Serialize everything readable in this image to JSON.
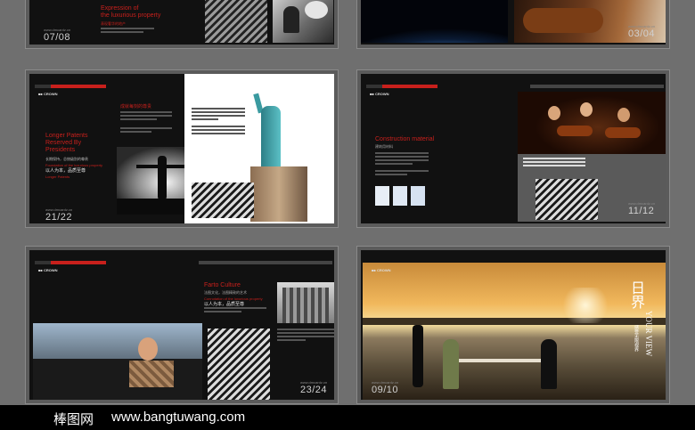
{
  "spreads": {
    "s1": {
      "title_line1": "Expression of",
      "title_line2": "the luxurious property",
      "title_cn": "表现奢华的地产",
      "url": "www.dmcardz.cn",
      "page": "07/08"
    },
    "s2": {
      "url": "www.dmcardz.cn",
      "page": "03/04"
    },
    "s3": {
      "heading_cn_small": "成就每刻的尊贵",
      "heading_line1": "Longer Patents",
      "heading_line2": "Reserved By",
      "heading_line3": "Presidents",
      "cn_red1": "长期保持，总统级别的尊贵",
      "en_red": "Foundation of the luxurious property",
      "cn_white": "以人为本，品质至尊",
      "en_small": "Longer Patents",
      "url": "www.dmcardz.cn",
      "page": "21/22"
    },
    "s4": {
      "heading": "Construction material",
      "heading_cn": "建筑用材料",
      "url": "www.dmcardz.cn",
      "page": "11/12"
    },
    "s5": {
      "heading": "Farto Culture",
      "heading_cn": "法图文化，法图精致的艺术",
      "en_red": "Connotation of the luxurious property",
      "cn_white": "以人为本，品质至尊",
      "url": "www.dmcardz.cn",
      "page": "23/24"
    },
    "s6": {
      "vertical_cn": "日界",
      "vertical_en": "YOUR VIEW",
      "vertical_cn2": "感受无限视界",
      "url": "www.dmcardz.cn",
      "page": "09/10"
    }
  },
  "footer": {
    "brand_cn": "棒图网",
    "url": "www.bangtuwang.com"
  },
  "colors": {
    "accent_red": "#c8201c",
    "page_bg": "#6f6f6f"
  }
}
